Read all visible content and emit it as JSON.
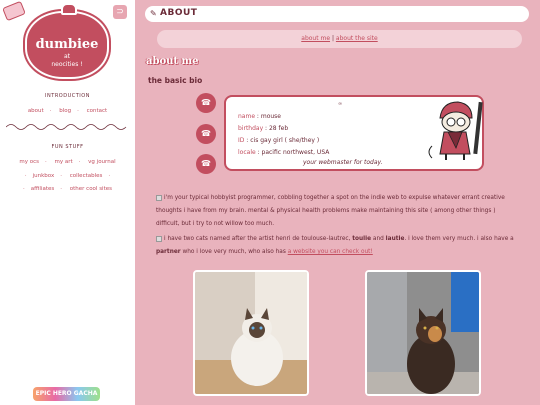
{
  "sidebar": {
    "logo_title": "dumbiee",
    "logo_sub1": "at",
    "logo_sub2": "neocities !",
    "intro_heading": "INTRODUCTION",
    "intro_links": [
      "about",
      "blog",
      "contact"
    ],
    "fun_heading": "FUN STUFF",
    "fun_links": [
      "my ocs",
      "my art",
      "vg journal",
      "junkbox",
      "collectables",
      "affiliates",
      "other cool sites"
    ],
    "badge": "EPIC HERO GACHA"
  },
  "header": {
    "title": "ABOUT"
  },
  "subnav": {
    "about_me": "about me",
    "separator": "|",
    "about_site": "about the site"
  },
  "main": {
    "heading": "about me",
    "subheading": "the basic bio",
    "card_mark": "∞",
    "bio": [
      {
        "key": "name",
        "value": " : mouse"
      },
      {
        "key": "birthday",
        "value": " : 28 feb"
      },
      {
        "key": "ID",
        "value": " : cis gay girl ( she/they )"
      },
      {
        "key": "locale",
        "value": " : pacific northwest, USA"
      }
    ],
    "bio_caption": "your webmaster for today.",
    "para1": "i'm your typical hobbyist programmer, cobbling together a spot on the indie web to expulse whatever errant creative thoughts i have from my brain. mental & physical health problems make maintaining this site ( among other things ) difficult, but i try to not willow too much.",
    "para2_a": "i have two cats named after the artist henri de toulouse-lautrec,",
    "para2_b": "toulie",
    "para2_c": "and",
    "para2_d": "lautie",
    "para2_e": ". i love them very much. i also have a",
    "para2_f": "partner",
    "para2_g": "who i love very much, who also has",
    "para2_link": "a website you can check out!",
    "side_icon": "☎"
  },
  "colors": {
    "accent": "#c24e5f",
    "background": "#e9b3bd",
    "text": "#6b2b38"
  }
}
